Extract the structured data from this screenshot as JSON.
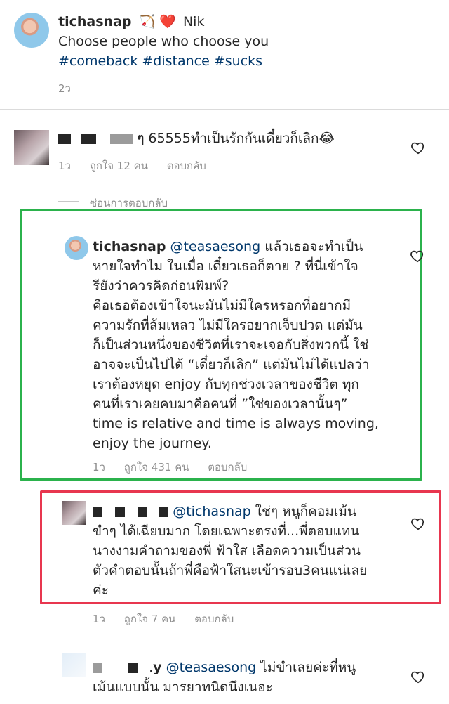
{
  "post": {
    "username": "tichasnap",
    "tagged": "Nik",
    "line1": "Choose people who choose you",
    "hashtags": "#comeback #distance #sucks",
    "time": "2ว"
  },
  "comment1": {
    "username_suffix": "ๆ",
    "text": "65555ทำเป็นรักกันเดี๋ยวก็เลิก😂",
    "time": "1ว",
    "likes": "ถูกใจ 12 คน",
    "reply": "ตอบกลับ",
    "hide_replies": "ซ่อนการตอบกลับ"
  },
  "reply1": {
    "username": "tichasnap",
    "mention": "@teasaesong",
    "lines": [
      "แล้วเธอจะทำเป็น",
      "หายใจทำไม ในเมื่อ เดี๋ยวเธอก็ตาย ?  ที่นี่เข้าใจ",
      "รียังว่าควรคิดก่อนพิมพ์?",
      "คือเธอต้องเข้าใจนะมันไม่มีใครหรอกที่อยากมี",
      "ความรักที่ล้มเหลว ไม่มีใครอยากเจ็บปวด แต่มัน",
      "ก็เป็นส่วนหนึ่งของชีวิตที่เราจะเจอกับสิ่งพวกนี้ ใช่",
      "อาจจะเป็นไปได้ “เดี๋ยวก็เลิก” แต่มันไม่ได้แปลว่า",
      "เราต้องหยุด enjoy กับทุกช่วงเวลาของชีวิต ทุก",
      "คนที่เราเคยคบมาคือคนที่ ”ใช่ของเวลานั้นๆ”",
      "time is relative and time is always moving,",
      "enjoy the journey."
    ],
    "time": "1ว",
    "likes": "ถูกใจ 431 คน",
    "reply": "ตอบกลับ"
  },
  "reply2": {
    "mention": "@tichasnap",
    "lines": [
      "ใช่ๆ หนูก็คอมเม้น",
      "ขำๆ ได้เฉียบมาก โดยเฉพาะตรงที่...พี่ตอบแทน",
      "นางงามคำถามของพี่ ฟ้าใส เลือดความเป็นส่วน",
      "ตัวคำตอบนั้นถ้าพี่คือฟ้าใสนะเข้ารอบ3คนแน่เลย",
      "ค่ะ"
    ],
    "time": "1ว",
    "likes": "ถูกใจ 7 คน",
    "reply": "ตอบกลับ"
  },
  "reply3": {
    "username_suffix": "y",
    "mention": "@teasaesong",
    "lines": [
      "ไม่ขำเลยค่ะที่หนู",
      "เม้นแบบนั้น มารยาทนิดนึงเนอะ"
    ]
  },
  "colors": {
    "mention": "#00376b",
    "green_box": "#2bb24c",
    "red_box": "#e8364f"
  }
}
